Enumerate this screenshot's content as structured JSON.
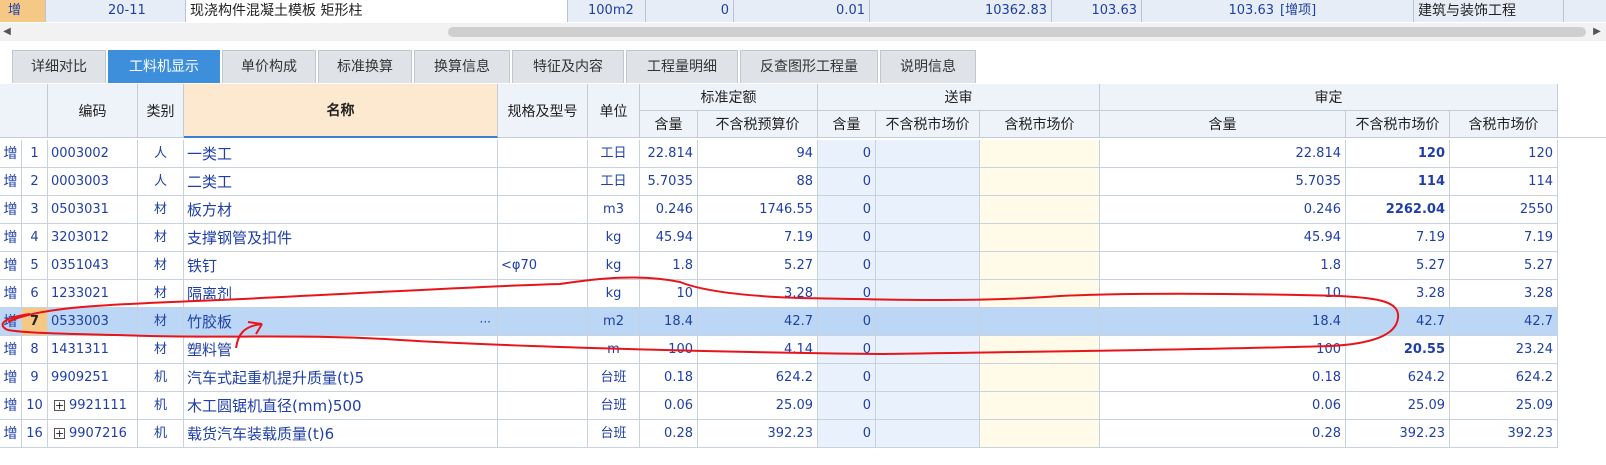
{
  "top_row": {
    "zeng": "增",
    "code": "20-11",
    "name": "现浇构件混凝土模板 矩形柱",
    "unit": "100m2",
    "qty": "0",
    "coef": "0.01",
    "total": "10362.83",
    "price1": "103.63",
    "price2": "103.63",
    "tag": "[增项]",
    "category": "建筑与装饰工程"
  },
  "scroll": {
    "left_arrow": "◀",
    "right_arrow": "▶"
  },
  "tabs": [
    "详细对比",
    "工料机显示",
    "单价构成",
    "标准换算",
    "换算信息",
    "特征及内容",
    "工程量明细",
    "反查图形工程量",
    "说明信息"
  ],
  "active_tab": 1,
  "headers": {
    "code": "编码",
    "type": "类别",
    "name": "名称",
    "spec": "规格及型号",
    "unit": "单位",
    "std_group": "标准定额",
    "send_group": "送审",
    "review_group": "审定",
    "std_qty": "含量",
    "std_price": "不含税预算价",
    "send_qty": "含量",
    "send_price_ex": "不含税市场价",
    "send_price_in": "含税市场价",
    "rev_qty": "含量",
    "rev_price_ex": "不含税市场价",
    "rev_price_in": "含税市场价"
  },
  "rows": [
    {
      "zeng": "增",
      "num": "1",
      "code": "0003002",
      "type": "人",
      "name": "一类工",
      "spec": "",
      "unit": "工日",
      "std_qty": "22.814",
      "std_price": "94",
      "send_qty": "0",
      "rev_qty": "22.814",
      "rev_ex": "120",
      "rev_in": "120",
      "rev_ex_bold": true,
      "expand": false
    },
    {
      "zeng": "增",
      "num": "2",
      "code": "0003003",
      "type": "人",
      "name": "二类工",
      "spec": "",
      "unit": "工日",
      "std_qty": "5.7035",
      "std_price": "88",
      "send_qty": "0",
      "rev_qty": "5.7035",
      "rev_ex": "114",
      "rev_in": "114",
      "rev_ex_bold": true,
      "expand": false
    },
    {
      "zeng": "增",
      "num": "3",
      "code": "0503031",
      "type": "材",
      "name": "板方材",
      "spec": "",
      "unit": "m3",
      "std_qty": "0.246",
      "std_price": "1746.55",
      "send_qty": "0",
      "rev_qty": "0.246",
      "rev_ex": "2262.04",
      "rev_in": "2550",
      "rev_ex_bold": true,
      "expand": false
    },
    {
      "zeng": "增",
      "num": "4",
      "code": "3203012",
      "type": "材",
      "name": "支撑钢管及扣件",
      "spec": "",
      "unit": "kg",
      "std_qty": "45.94",
      "std_price": "7.19",
      "send_qty": "0",
      "rev_qty": "45.94",
      "rev_ex": "7.19",
      "rev_in": "7.19",
      "rev_ex_bold": false,
      "expand": false
    },
    {
      "zeng": "增",
      "num": "5",
      "code": "0351043",
      "type": "材",
      "name": "铁钉",
      "spec": "<φ70",
      "unit": "kg",
      "std_qty": "1.8",
      "std_price": "5.27",
      "send_qty": "0",
      "rev_qty": "1.8",
      "rev_ex": "5.27",
      "rev_in": "5.27",
      "rev_ex_bold": false,
      "expand": false
    },
    {
      "zeng": "增",
      "num": "6",
      "code": "1233021",
      "type": "材",
      "name": "隔离剂",
      "spec": "",
      "unit": "kg",
      "std_qty": "10",
      "std_price": "3.28",
      "send_qty": "0",
      "rev_qty": "10",
      "rev_ex": "3.28",
      "rev_in": "3.28",
      "rev_ex_bold": false,
      "expand": false
    },
    {
      "zeng": "增",
      "num": "7",
      "code": "0533003",
      "type": "材",
      "name": "竹胶板",
      "spec": "",
      "unit": "m2",
      "std_qty": "18.4",
      "std_price": "42.7",
      "send_qty": "0",
      "rev_qty": "18.4",
      "rev_ex": "42.7",
      "rev_in": "42.7",
      "rev_ex_bold": false,
      "expand": false,
      "selected": true,
      "ellipsis": "···"
    },
    {
      "zeng": "增",
      "num": "8",
      "code": "1431311",
      "type": "材",
      "name": "塑料管",
      "spec": "",
      "unit": "m",
      "std_qty": "100",
      "std_price": "4.14",
      "send_qty": "0",
      "rev_qty": "100",
      "rev_ex": "20.55",
      "rev_in": "23.24",
      "rev_ex_bold": true,
      "expand": false
    },
    {
      "zeng": "增",
      "num": "9",
      "code": "9909251",
      "type": "机",
      "name": "汽车式起重机提升质量(t)5",
      "spec": "",
      "unit": "台班",
      "std_qty": "0.18",
      "std_price": "624.2",
      "send_qty": "0",
      "rev_qty": "0.18",
      "rev_ex": "624.2",
      "rev_in": "624.2",
      "rev_ex_bold": false,
      "expand": false
    },
    {
      "zeng": "增",
      "num": "10",
      "code": "9921111",
      "type": "机",
      "name": "木工圆锯机直径(mm)500",
      "spec": "",
      "unit": "台班",
      "std_qty": "0.06",
      "std_price": "25.09",
      "send_qty": "0",
      "rev_qty": "0.06",
      "rev_ex": "25.09",
      "rev_in": "25.09",
      "rev_ex_bold": false,
      "expand": true
    },
    {
      "zeng": "增",
      "num": "16",
      "code": "9907216",
      "type": "机",
      "name": "载货汽车装载质量(t)6",
      "spec": "",
      "unit": "台班",
      "std_qty": "0.28",
      "std_price": "392.23",
      "send_qty": "0",
      "rev_qty": "0.28",
      "rev_ex": "392.23",
      "rev_in": "392.23",
      "rev_ex_bold": false,
      "expand": true
    }
  ],
  "expand_symbol": "+",
  "colors": {
    "accent": "#3d8fdb",
    "annotation": "#e8141b",
    "selected_row": "#bcd7f5",
    "header_name": "#fde9cf"
  }
}
